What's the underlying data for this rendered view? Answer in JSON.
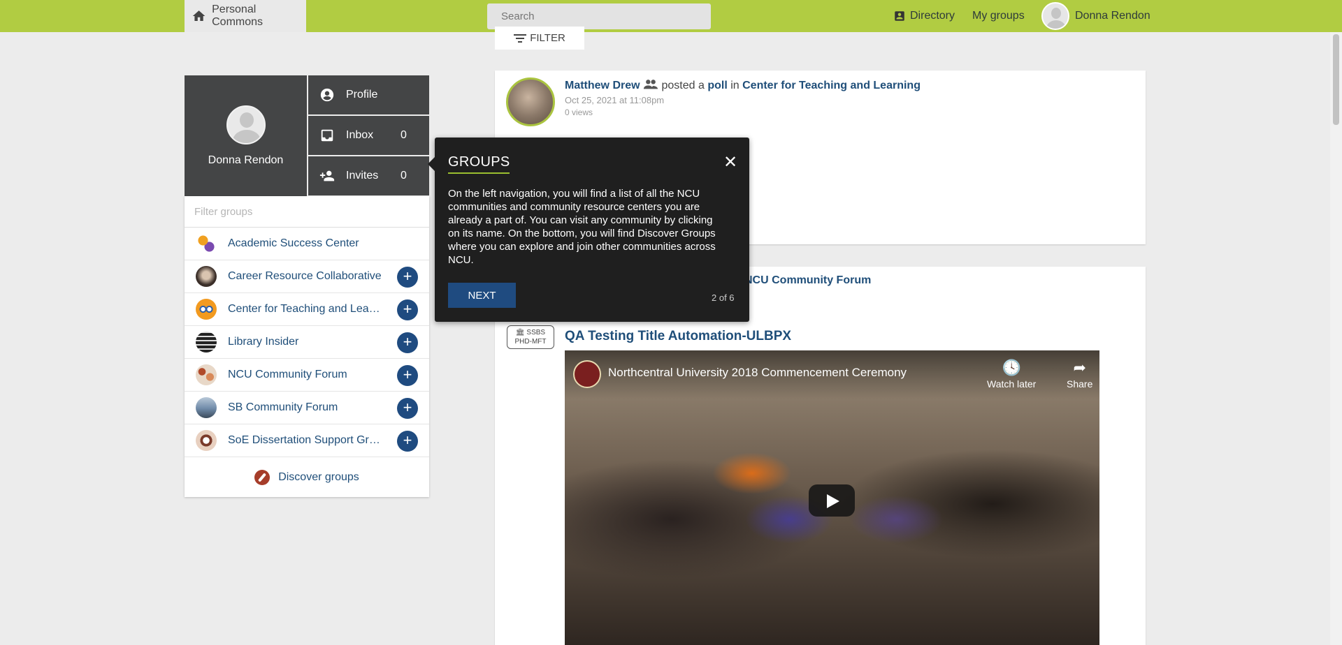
{
  "topbar": {
    "home_label": "Personal Commons",
    "search_placeholder": "Search",
    "directory_label": "Directory",
    "my_groups_label": "My groups",
    "user_name": "Donna Rendon"
  },
  "filter_label": "FILTER",
  "profile": {
    "name": "Donna Rendon",
    "links": [
      {
        "label": "Profile",
        "count": "",
        "icon": "account-circle-icon"
      },
      {
        "label": "Inbox",
        "count": "0",
        "icon": "inbox-icon"
      },
      {
        "label": "Invites",
        "count": "0",
        "icon": "person-add-icon"
      }
    ]
  },
  "groups": {
    "filter_placeholder": "Filter groups",
    "items": [
      {
        "name": "Academic Success Center",
        "has_plus": false
      },
      {
        "name": "Career Resource Collaborative",
        "has_plus": true
      },
      {
        "name": "Center for Teaching and Lea…",
        "has_plus": true
      },
      {
        "name": "Library Insider",
        "has_plus": true
      },
      {
        "name": "NCU Community Forum",
        "has_plus": true
      },
      {
        "name": "SB Community Forum",
        "has_plus": true
      },
      {
        "name": "SoE Dissertation Support Gr…",
        "has_plus": true
      }
    ],
    "discover_label": "Discover groups"
  },
  "post1": {
    "author": "Matthew Drew",
    "action": "posted a",
    "type": "poll",
    "in_word": "in",
    "group": "Center for Teaching and Learning",
    "date": "Oct 25, 2021 at 11:08pm",
    "views": "0 views"
  },
  "post2": {
    "forum": "NCU Community Forum",
    "tag_line1": "🏛 SSBS",
    "tag_line2": "PHD-MFT",
    "title": "QA Testing Title Automation-ULBPX",
    "video_title": "Northcentral University 2018 Commencement Ceremony",
    "watch_later": "Watch later",
    "share": "Share"
  },
  "tour": {
    "title": "GROUPS",
    "body": "On the left navigation, you will find a list of all the NCU communities and community resource centers you are already a part of. You can visit any community by clicking on its name. On the bottom, you will find Discover Groups where you can explore and join other communities across NCU.",
    "next_label": "NEXT",
    "step": "2 of 6",
    "close": "✕"
  },
  "colors": {
    "topbar": "#b1cc42",
    "navy": "#1f4b80",
    "link": "#1f4e79",
    "dark_panel": "#444546",
    "tooltip": "#1f1f1f"
  }
}
